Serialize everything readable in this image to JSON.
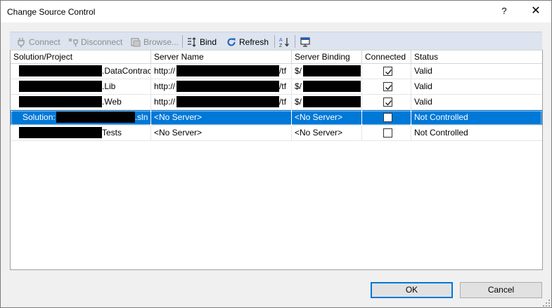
{
  "window": {
    "title": "Change Source Control",
    "help_glyph": "?",
    "close_glyph": "✕"
  },
  "toolbar": {
    "connect": "Connect",
    "disconnect": "Disconnect",
    "browse": "Browse...",
    "bind": "Bind",
    "refresh": "Refresh",
    "colors": {
      "bg": "#dde3ef",
      "disabled_text": "#8d8d8d",
      "accent_icon": "#1e5fb4"
    }
  },
  "grid": {
    "columns": {
      "project": "Solution/Project",
      "server": "Server Name",
      "binding": "Server Binding",
      "connected": "Connected",
      "status": "Status"
    },
    "rows": [
      {
        "project_suffix": ".DataContract",
        "server": "http://",
        "server_tail": "/tf",
        "binding": "$/",
        "connected": true,
        "status": "Valid",
        "selected": false
      },
      {
        "project_suffix": ".Lib",
        "server": "http://",
        "server_tail": "/tf",
        "binding": "$/",
        "connected": true,
        "status": "Valid",
        "selected": false
      },
      {
        "project_suffix": ".Web",
        "server": "http://",
        "server_tail": "/tf",
        "binding": "$/",
        "connected": true,
        "status": "Valid",
        "selected": false
      },
      {
        "project_prefix": "Solution:",
        "project_suffix": ".sln",
        "server": "<No Server>",
        "binding": "<No Server>",
        "connected": false,
        "status": "Not Controlled",
        "selected": true
      },
      {
        "project_suffix": "Tests",
        "server": "<No Server>",
        "binding": "<No Server>",
        "connected": false,
        "status": "Not Controlled",
        "selected": false
      }
    ],
    "colors": {
      "selection": "#0078d7"
    }
  },
  "buttons": {
    "ok": "OK",
    "cancel": "Cancel"
  }
}
